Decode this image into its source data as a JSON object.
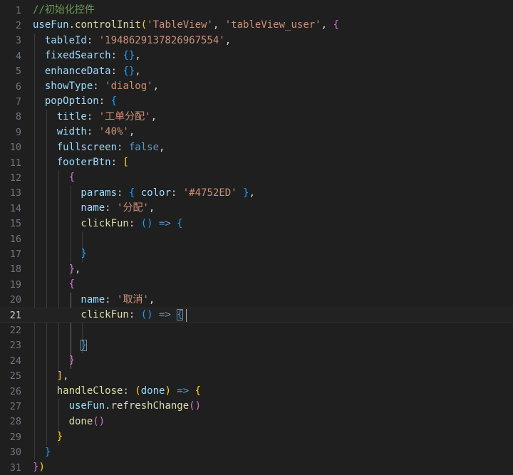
{
  "editor": {
    "line_numbers": [
      "1",
      "2",
      "3",
      "4",
      "5",
      "6",
      "7",
      "8",
      "9",
      "10",
      "11",
      "12",
      "13",
      "14",
      "15",
      "16",
      "17",
      "18",
      "19",
      "20",
      "21",
      "22",
      "23",
      "24",
      "25",
      "26",
      "27",
      "28",
      "29",
      "30",
      "31"
    ],
    "active_line": "21",
    "lines": [
      [
        {
          "t": "//初始化控件",
          "c": "comment"
        }
      ],
      [
        {
          "t": "useFun",
          "c": "var"
        },
        {
          "t": ".",
          "c": "punc"
        },
        {
          "t": "controlInit",
          "c": "fn"
        },
        {
          "t": "(",
          "c": "b1"
        },
        {
          "t": "'TableView'",
          "c": "str"
        },
        {
          "t": ", ",
          "c": "punc"
        },
        {
          "t": "'tableView_user'",
          "c": "str"
        },
        {
          "t": ", ",
          "c": "punc"
        },
        {
          "t": "{",
          "c": "b2"
        }
      ],
      [
        {
          "t": "  tableId",
          "c": "var"
        },
        {
          "t": ": ",
          "c": "punc"
        },
        {
          "t": "'1948629137826967554'",
          "c": "str"
        },
        {
          "t": ",",
          "c": "punc"
        }
      ],
      [
        {
          "t": "  fixedSearch",
          "c": "var"
        },
        {
          "t": ": ",
          "c": "punc"
        },
        {
          "t": "{}",
          "c": "b3"
        },
        {
          "t": ",",
          "c": "punc"
        }
      ],
      [
        {
          "t": "  enhanceData",
          "c": "var"
        },
        {
          "t": ": ",
          "c": "punc"
        },
        {
          "t": "{}",
          "c": "b3"
        },
        {
          "t": ",",
          "c": "punc"
        }
      ],
      [
        {
          "t": "  showType",
          "c": "var"
        },
        {
          "t": ": ",
          "c": "punc"
        },
        {
          "t": "'dialog'",
          "c": "str"
        },
        {
          "t": ",",
          "c": "punc"
        }
      ],
      [
        {
          "t": "  popOption",
          "c": "var"
        },
        {
          "t": ": ",
          "c": "punc"
        },
        {
          "t": "{",
          "c": "b3"
        }
      ],
      [
        {
          "t": "    title",
          "c": "var"
        },
        {
          "t": ": ",
          "c": "punc"
        },
        {
          "t": "'工单分配'",
          "c": "str"
        },
        {
          "t": ",",
          "c": "punc"
        }
      ],
      [
        {
          "t": "    width",
          "c": "var"
        },
        {
          "t": ": ",
          "c": "punc"
        },
        {
          "t": "'40%'",
          "c": "str"
        },
        {
          "t": ",",
          "c": "punc"
        }
      ],
      [
        {
          "t": "    fullscreen",
          "c": "var"
        },
        {
          "t": ": ",
          "c": "punc"
        },
        {
          "t": "false",
          "c": "kw"
        },
        {
          "t": ",",
          "c": "punc"
        }
      ],
      [
        {
          "t": "    footerBtn",
          "c": "var"
        },
        {
          "t": ": ",
          "c": "punc"
        },
        {
          "t": "[",
          "c": "b1"
        }
      ],
      [
        {
          "t": "      ",
          "c": "punc"
        },
        {
          "t": "{",
          "c": "b2"
        }
      ],
      [
        {
          "t": "        params",
          "c": "var"
        },
        {
          "t": ": ",
          "c": "punc"
        },
        {
          "t": "{",
          "c": "b3"
        },
        {
          "t": " color",
          "c": "var"
        },
        {
          "t": ": ",
          "c": "punc"
        },
        {
          "t": "'#4752ED'",
          "c": "str"
        },
        {
          "t": " ",
          "c": "punc"
        },
        {
          "t": "}",
          "c": "b3"
        },
        {
          "t": ",",
          "c": "punc"
        }
      ],
      [
        {
          "t": "        name",
          "c": "var"
        },
        {
          "t": ": ",
          "c": "punc"
        },
        {
          "t": "'分配'",
          "c": "str"
        },
        {
          "t": ",",
          "c": "punc"
        }
      ],
      [
        {
          "t": "        clickFun",
          "c": "fn"
        },
        {
          "t": ": ",
          "c": "punc"
        },
        {
          "t": "()",
          "c": "b3"
        },
        {
          "t": " => ",
          "c": "kw"
        },
        {
          "t": "{",
          "c": "b3"
        }
      ],
      [],
      [
        {
          "t": "        ",
          "c": "punc"
        },
        {
          "t": "}",
          "c": "b3"
        }
      ],
      [
        {
          "t": "      ",
          "c": "punc"
        },
        {
          "t": "}",
          "c": "b2"
        },
        {
          "t": ",",
          "c": "punc"
        }
      ],
      [
        {
          "t": "      ",
          "c": "punc"
        },
        {
          "t": "{",
          "c": "b2"
        }
      ],
      [
        {
          "t": "        name",
          "c": "var"
        },
        {
          "t": ": ",
          "c": "punc"
        },
        {
          "t": "'取消'",
          "c": "str"
        },
        {
          "t": ",",
          "c": "punc"
        }
      ],
      [
        {
          "t": "        clickFun",
          "c": "fn"
        },
        {
          "t": ": ",
          "c": "punc"
        },
        {
          "t": "()",
          "c": "b3"
        },
        {
          "t": " => ",
          "c": "kw"
        },
        {
          "t": "{",
          "c": "b3 bm"
        }
      ],
      [],
      [
        {
          "t": "        ",
          "c": "punc"
        },
        {
          "t": "}",
          "c": "b3 bm"
        }
      ],
      [
        {
          "t": "      ",
          "c": "punc"
        },
        {
          "t": "}",
          "c": "b2"
        }
      ],
      [
        {
          "t": "    ",
          "c": "punc"
        },
        {
          "t": "]",
          "c": "b1"
        },
        {
          "t": ",",
          "c": "punc"
        }
      ],
      [
        {
          "t": "    handleClose",
          "c": "fn"
        },
        {
          "t": ": ",
          "c": "punc"
        },
        {
          "t": "(",
          "c": "b1"
        },
        {
          "t": "done",
          "c": "var"
        },
        {
          "t": ")",
          "c": "b1"
        },
        {
          "t": " => ",
          "c": "kw"
        },
        {
          "t": "{",
          "c": "b1"
        }
      ],
      [
        {
          "t": "      useFun",
          "c": "var"
        },
        {
          "t": ".",
          "c": "punc"
        },
        {
          "t": "refreshChange",
          "c": "fn"
        },
        {
          "t": "()",
          "c": "b2"
        }
      ],
      [
        {
          "t": "      done",
          "c": "fn"
        },
        {
          "t": "()",
          "c": "b2"
        }
      ],
      [
        {
          "t": "    ",
          "c": "punc"
        },
        {
          "t": "}",
          "c": "b1"
        }
      ],
      [
        {
          "t": "  ",
          "c": "punc"
        },
        {
          "t": "}",
          "c": "b3"
        }
      ],
      [
        {
          "t": "}",
          "c": "b2"
        },
        {
          "t": ")",
          "c": "b1"
        }
      ]
    ]
  },
  "colors": {
    "background": "#1f1f1f",
    "comment": "#6a9955",
    "string": "#ce9178",
    "property": "#9cdcfe",
    "function": "#dcdcaa",
    "keyword": "#569cd6",
    "bracket_gold": "#ffd700",
    "bracket_orchid": "#da70d6",
    "bracket_blue": "#179fff"
  }
}
